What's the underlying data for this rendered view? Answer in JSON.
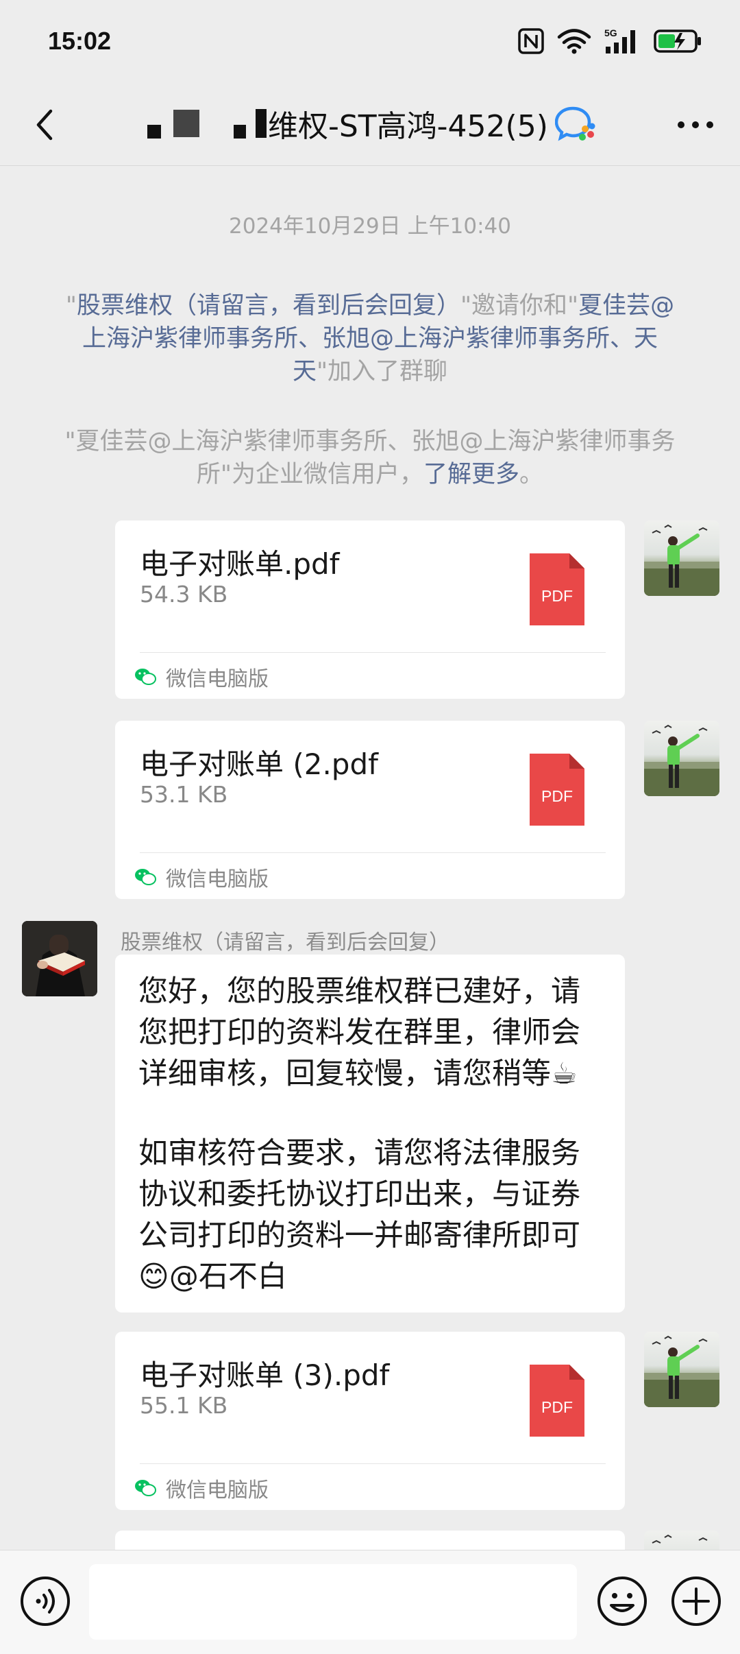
{
  "status_bar": {
    "time": "15:02",
    "network": "5G"
  },
  "nav": {
    "title_visible": "维权-ST高鸿-452(5)",
    "back_icon": "chevron-left-icon",
    "more_icon": "more-dots-icon",
    "badge_icon": "wecom-group-icon"
  },
  "chat": {
    "timestamp": "2024年10月29日 上午10:40",
    "system_invite": {
      "q1": "\"",
      "inviter": "股票维权（请留言，看到后会回复）",
      "mid": "\"邀请你和\"",
      "invitee1": "夏佳芸@上海沪紫律师事务所",
      "sep1": "、",
      "invitee2": "张旭@上海沪紫律师事务所",
      "sep2": "、",
      "invitee3": "天天",
      "end": "\"加入了群聊"
    },
    "system_wecom": {
      "text": "\"夏佳芸@上海沪紫律师事务所、张旭@上海沪紫律师事务所\"为企业微信用户，",
      "link": "了解更多",
      "end": "。"
    },
    "files": [
      {
        "name": "电子对账单.pdf",
        "size": "54.3 KB",
        "badge": "PDF",
        "source": "微信电脑版"
      },
      {
        "name": "电子对账单 (2.pdf",
        "size": "53.1 KB",
        "badge": "PDF",
        "source": "微信电脑版"
      },
      {
        "name": "电子对账单 (3).pdf",
        "size": "55.1 KB",
        "badge": "PDF",
        "source": "微信电脑版"
      }
    ],
    "lawyer_message": {
      "sender": "股票维权（请留言，看到后会回复）",
      "paragraph1": "您好，您的股票维权群已建好，请您把打印的资料发在群里，律师会详细审核，回复较慢，请您稍等☕",
      "paragraph2": "如审核符合要求，请您将法律服务协议和委托协议打印出来，与证券公司打印的资料一并邮寄律所即可😊@石不白"
    }
  },
  "input_bar": {
    "voice_icon": "voice-icon",
    "emoji_icon": "emoji-icon",
    "plus_icon": "plus-icon",
    "placeholder": ""
  },
  "colors": {
    "background": "#ededed",
    "bubble": "#ffffff",
    "link": "#576b95",
    "system_text": "#a4a4a4",
    "pdf_red": "#e94848",
    "wechat_green": "#07c160"
  }
}
